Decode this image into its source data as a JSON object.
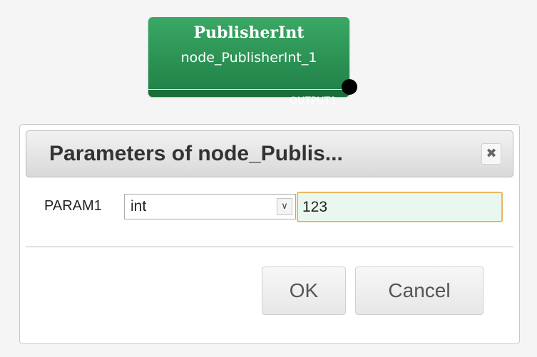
{
  "node": {
    "type_label": "PublisherInt",
    "name_label": "node_PublisherInt_1",
    "output_port_label": "OUTPUT1"
  },
  "dialog": {
    "title": "Parameters of node_Publis...",
    "close_icon": "close-icon",
    "param": {
      "label": "PARAM1",
      "type_selected": "int",
      "value": "123"
    },
    "buttons": {
      "ok": "OK",
      "cancel": "Cancel"
    }
  },
  "colors": {
    "node_green": "#2a9656",
    "node_bottom": "#1a6e3a",
    "input_focus_border": "#e6b95c",
    "input_background": "#e9f7ef"
  }
}
